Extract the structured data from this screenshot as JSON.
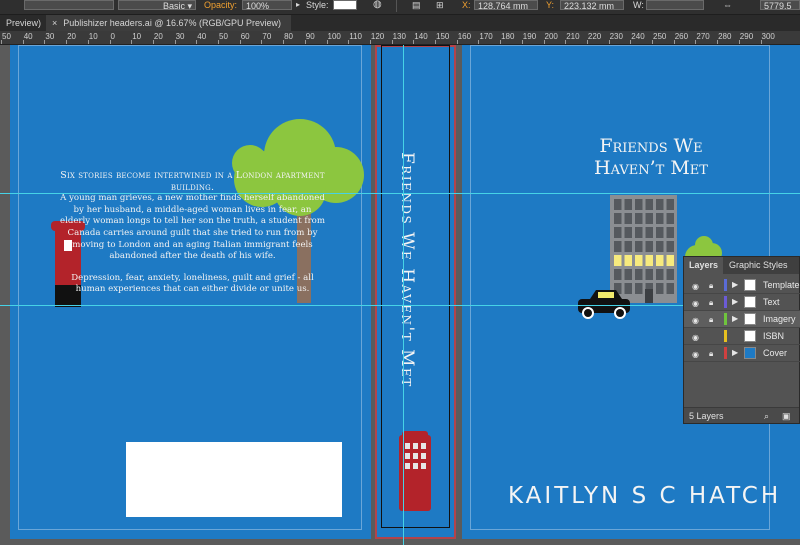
{
  "control_bar": {
    "brush_label": "Basic",
    "opacity_label": "Opacity:",
    "opacity_value": "100%",
    "style_label": "Style:",
    "x_label": "X:",
    "x_value": "128.764 mm",
    "y_label": "Y:",
    "y_value": "223.132 mm",
    "w_label": "W:",
    "w_value": "5779.5"
  },
  "tabs": [
    {
      "label": "Preview)"
    },
    {
      "label": "Publishizer headers.ai @ 16.67% (RGB/GPU Preview)"
    }
  ],
  "ruler": {
    "ticks": [
      "50",
      "40",
      "30",
      "20",
      "10",
      "0",
      "10",
      "20",
      "30",
      "40",
      "50",
      "60",
      "70",
      "80",
      "90",
      "100",
      "110",
      "120",
      "130",
      "140",
      "150",
      "160",
      "170",
      "180",
      "190",
      "200",
      "210",
      "220",
      "230",
      "240",
      "250",
      "260",
      "270",
      "280",
      "290",
      "300"
    ]
  },
  "cover": {
    "blurb_lead": "Six stories become intertwined in a London apartment building.",
    "blurb_body": "A young man grieves, a new mother finds herself abandoned by her husband, a middle-aged woman lives in fear, an elderly woman longs to tell her son the truth, a student from Canada carries around guilt that she tried to run from by moving to London and an aging Italian immigrant feels abandoned after the death of his wife.",
    "blurb_tail": "Depression, fear, anxiety, loneliness, guilt and grief - all human experiences that can either divide or unite us.",
    "spine_title": "Friends We Haven't Met",
    "title_line1": "Friends We",
    "title_line2": "Haven’t Met",
    "author": "KAITLYN S C HATCH",
    "colors": {
      "cover_blue": "#1e7ac4",
      "guide": "#46d3e6",
      "tree_green": "#8cc63f",
      "post_red": "#b3232a"
    }
  },
  "layers_panel": {
    "tab_layers": "Layers",
    "tab_graphic_styles": "Graphic Styles",
    "layers": [
      {
        "name": "Template",
        "color": "#5a6bd6"
      },
      {
        "name": "Text",
        "color": "#6b5bd6"
      },
      {
        "name": "Imagery",
        "color": "#6fc43d"
      },
      {
        "name": "ISBN",
        "color": "#e6c020"
      },
      {
        "name": "Cover",
        "color": "#d04040"
      }
    ],
    "footer": "5 Layers",
    "icons": {
      "eye": "eye-icon",
      "lock": "lock-icon",
      "expand": "triangle-right-icon"
    }
  }
}
